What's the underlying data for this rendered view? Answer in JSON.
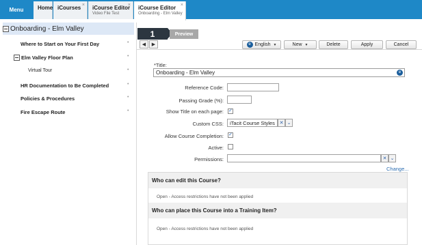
{
  "topbar": {
    "menu_label": "Menu",
    "tabs": [
      {
        "title": "Home",
        "subtitle": "",
        "closable": false
      },
      {
        "title": "iCourses",
        "subtitle": "",
        "closable": true
      },
      {
        "title": "iCourse Editor",
        "subtitle": "Video File Test",
        "closable": true
      },
      {
        "title": "iCourse Editor",
        "subtitle": "Onboarding - Elm Valley",
        "closable": true,
        "active": true
      }
    ],
    "close_glyph": "×"
  },
  "tree": {
    "root_label": "Onboarding - Elm Valley",
    "items": [
      {
        "label": "Where to Start on Your First Day",
        "dot": "•"
      },
      {
        "label": "Elm Valley Floor Plan",
        "dot": "•"
      },
      {
        "label": "Virtual Tour",
        "dot": "•"
      },
      {
        "label": "HR Documentation to Be Completed",
        "dot": "•"
      },
      {
        "label": "Policies & Procedures",
        "dot": "•"
      },
      {
        "label": "Fire Escape Route",
        "dot": "•"
      }
    ]
  },
  "editor": {
    "step_number": "1",
    "preview_label": "Preview",
    "nav_prev": "◀",
    "nav_next": "▶",
    "toolbar": {
      "language_label": "English",
      "new_label": "New",
      "delete_label": "Delete",
      "apply_label": "Apply",
      "cancel_label": "Cancel",
      "caret": "▼"
    },
    "fields": {
      "title_label": "*Title:",
      "title_value": "Onboarding - Elm Valley",
      "reference_code_label": "Reference Code:",
      "reference_code_value": "",
      "passing_grade_label": "Passing Grade (%):",
      "passing_grade_value": "",
      "show_title_label": "Show Title on each page:",
      "show_title_checked": "✓",
      "custom_css_label": "Custom CSS:",
      "custom_css_value": "iTacit Course Styles",
      "clear_glyph": "✕",
      "dropdown_glyph": "⌄",
      "allow_completion_label": "Allow Course Completion:",
      "allow_completion_checked": "✓",
      "active_label": "Active:",
      "active_checked": "",
      "permissions_label": "Permissions:",
      "permissions_value": "",
      "change_link": "Change..."
    },
    "permissions": {
      "edit_heading": "Who can edit this Course?",
      "edit_note": "Open - Access restrictions have not been applied",
      "place_heading": "Who can place this Course into a Training Item?",
      "place_note": "Open - Access restrictions have not been applied"
    }
  },
  "colors": {
    "tab_bar": "#1e88c7",
    "tree_selected": "#dde8f6",
    "step_badge": "#2c3640",
    "link": "#2b6cb0"
  },
  "icons": {
    "globe": "globe-icon",
    "collapse": "minus-box-icon"
  }
}
